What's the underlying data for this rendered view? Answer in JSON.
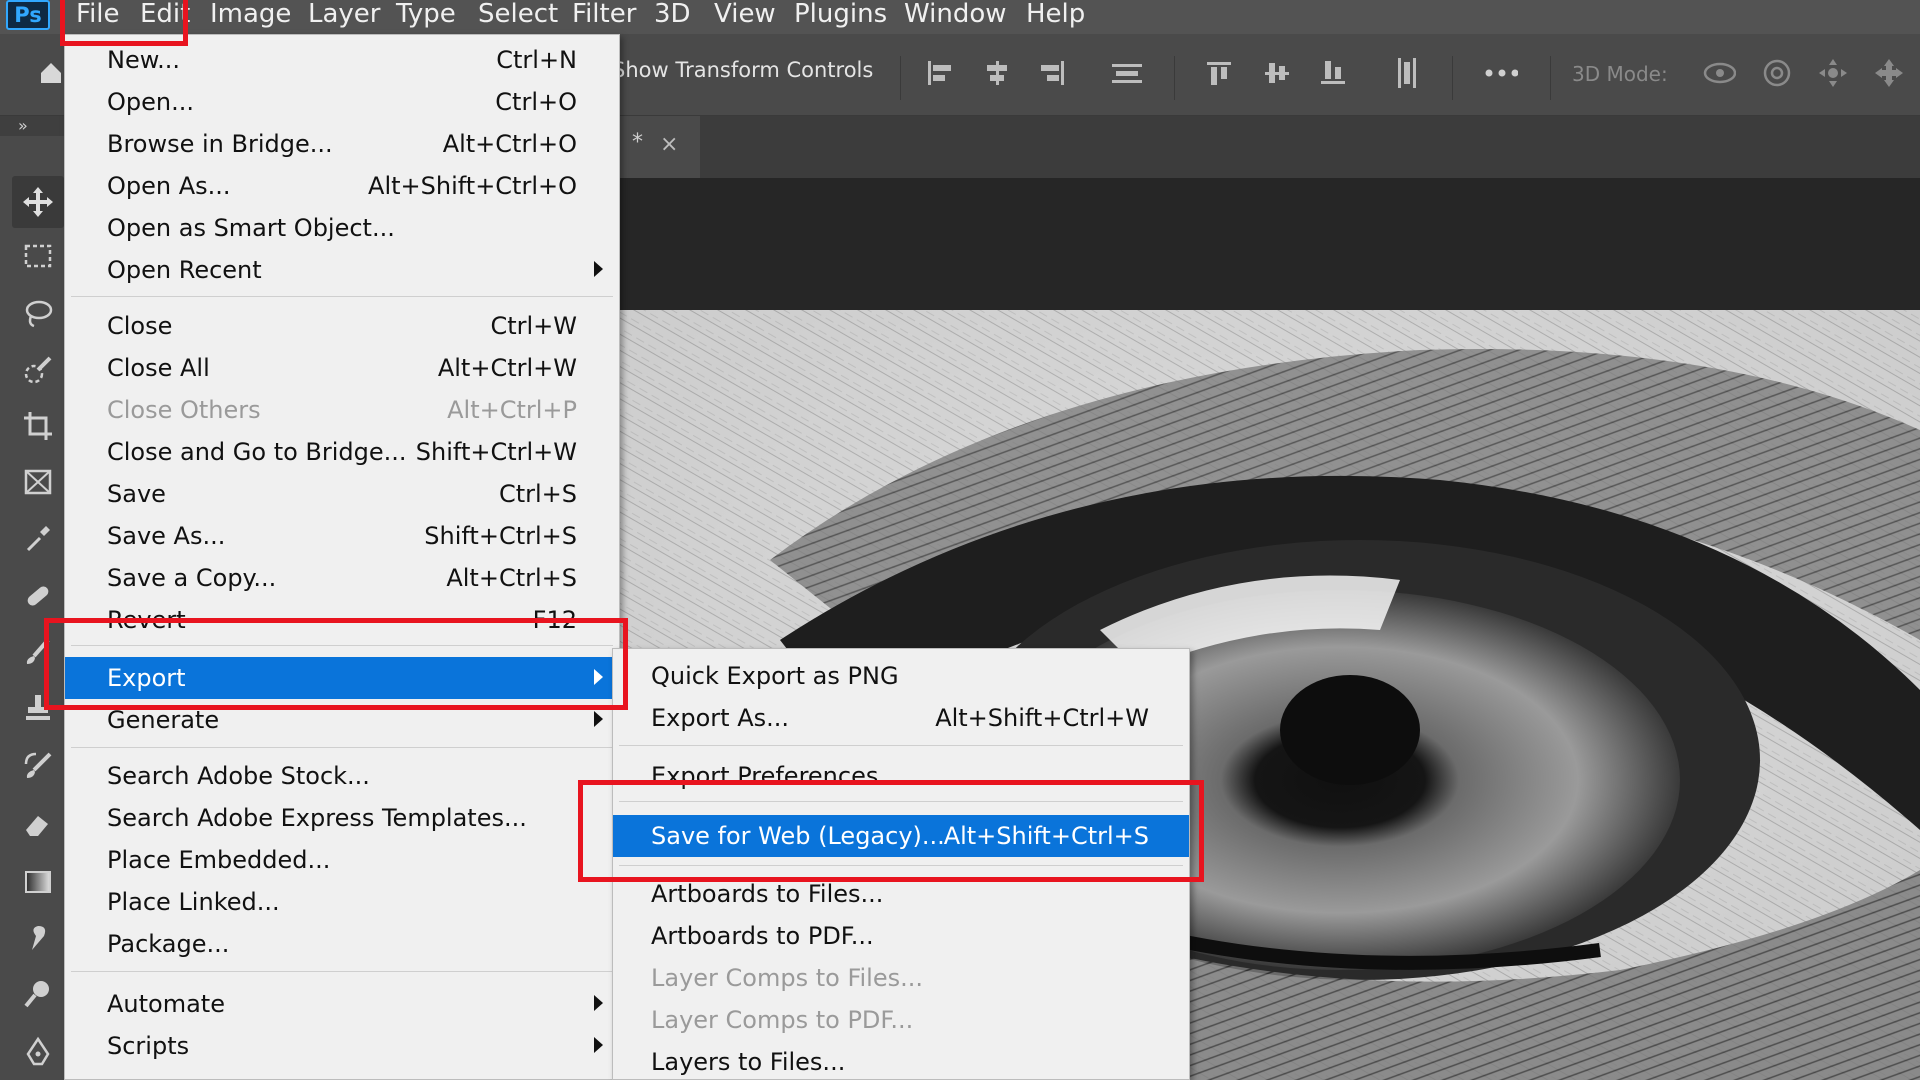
{
  "app": {
    "logo": "Ps"
  },
  "menubar": {
    "items": [
      "File",
      "Edit",
      "Image",
      "Layer",
      "Type",
      "Select",
      "Filter",
      "3D",
      "View",
      "Plugins",
      "Window",
      "Help"
    ]
  },
  "options_bar": {
    "show_transform_controls": "Show Transform Controls",
    "mode_label": "3D Mode:"
  },
  "doc_tab": {
    "modified_marker": "*",
    "close_glyph": "×"
  },
  "toolbar": {
    "collapse": "»"
  },
  "file_menu": {
    "items": [
      {
        "label": "New...",
        "shortcut": "Ctrl+N"
      },
      {
        "label": "Open...",
        "shortcut": "Ctrl+O"
      },
      {
        "label": "Browse in Bridge...",
        "shortcut": "Alt+Ctrl+O"
      },
      {
        "label": "Open As...",
        "shortcut": "Alt+Shift+Ctrl+O"
      },
      {
        "label": "Open as Smart Object...",
        "shortcut": ""
      },
      {
        "label": "Open Recent",
        "shortcut": ""
      },
      {
        "label": "Close",
        "shortcut": "Ctrl+W"
      },
      {
        "label": "Close All",
        "shortcut": "Alt+Ctrl+W"
      },
      {
        "label": "Close Others",
        "shortcut": "Alt+Ctrl+P"
      },
      {
        "label": "Close and Go to Bridge...",
        "shortcut": "Shift+Ctrl+W"
      },
      {
        "label": "Save",
        "shortcut": "Ctrl+S"
      },
      {
        "label": "Save As...",
        "shortcut": "Shift+Ctrl+S"
      },
      {
        "label": "Save a Copy...",
        "shortcut": "Alt+Ctrl+S"
      },
      {
        "label": "Revert",
        "shortcut": "F12"
      },
      {
        "label": "Export",
        "shortcut": ""
      },
      {
        "label": "Generate",
        "shortcut": ""
      },
      {
        "label": "Search Adobe Stock...",
        "shortcut": ""
      },
      {
        "label": "Search Adobe Express Templates...",
        "shortcut": ""
      },
      {
        "label": "Place Embedded...",
        "shortcut": ""
      },
      {
        "label": "Place Linked...",
        "shortcut": ""
      },
      {
        "label": "Package...",
        "shortcut": ""
      },
      {
        "label": "Automate",
        "shortcut": ""
      },
      {
        "label": "Scripts",
        "shortcut": ""
      }
    ]
  },
  "export_submenu": {
    "items": [
      {
        "label": "Quick Export as PNG",
        "shortcut": ""
      },
      {
        "label": "Export As...",
        "shortcut": "Alt+Shift+Ctrl+W"
      },
      {
        "label": "Export Preferences...",
        "shortcut": ""
      },
      {
        "label": "Save for Web (Legacy)...",
        "shortcut": "Alt+Shift+Ctrl+S"
      },
      {
        "label": "Artboards to Files...",
        "shortcut": ""
      },
      {
        "label": "Artboards to PDF...",
        "shortcut": ""
      },
      {
        "label": "Layer Comps to Files...",
        "shortcut": ""
      },
      {
        "label": "Layer Comps to PDF...",
        "shortcut": ""
      },
      {
        "label": "Layers to Files...",
        "shortcut": ""
      }
    ]
  },
  "colors": {
    "menu_highlight": "#0a74da",
    "annotation_red": "#e8141f",
    "menubar_bg": "#535353",
    "menu_bg": "#f0f0f0"
  }
}
